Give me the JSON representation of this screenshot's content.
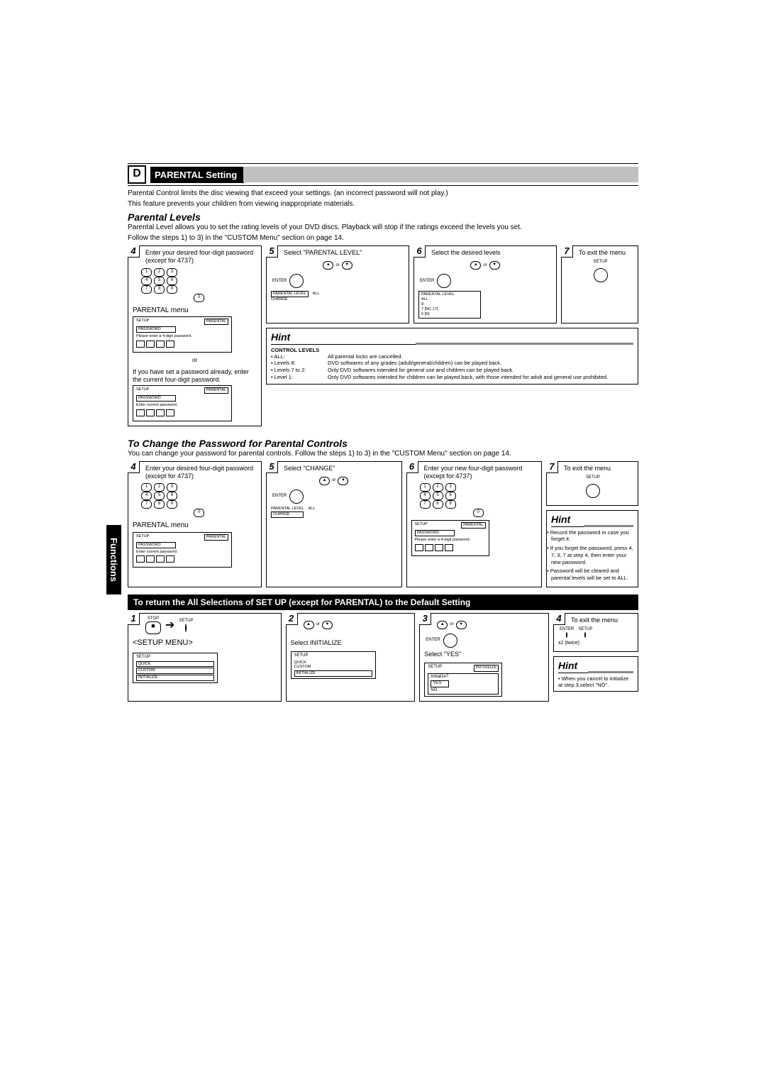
{
  "section": {
    "letter": "D",
    "title": "PARENTAL Setting",
    "intro1": "Parental Control limits the disc viewing that exceed your settings. (an incorrect password will not play.)",
    "intro2": "This feature prevents your children from viewing inappropriate materials.",
    "sub1": "Parental Levels",
    "sub1_desc1": "Parental Level allows you to set the rating levels of your DVD discs. Playback will stop if the ratings exceed the levels you set.",
    "sub1_desc2": "Follow the steps 1) to 3) in the \"CUSTOM Menu\" section on page 14."
  },
  "steps_pl": {
    "s4": {
      "num": "4",
      "text": "Enter your desired four-digit password (except for 4737)",
      "menu_cap": "PARENTAL menu",
      "or": "or",
      "or_text": "If you have set a password already, enter the current four-digit password."
    },
    "s5": {
      "num": "5",
      "text": "Select \"PARENTAL LEVEL\""
    },
    "s6": {
      "num": "6",
      "text": "Select the desired levels"
    },
    "s7": {
      "num": "7",
      "text": "To exit the menu"
    }
  },
  "mini1": {
    "setup": "SETUP",
    "tab": "PARENTAL",
    "pw": "PASSWORD",
    "prompt": "Please enter a 4-digit password.",
    "prompt2": "Enter current password."
  },
  "mini_pl": {
    "label": "PARENTAL LEVEL",
    "val": "ALL",
    "change": "CHANGE",
    "list": [
      "ALL",
      "8",
      "7 [NC-17]",
      "6 [R]"
    ]
  },
  "enter": "ENTER",
  "setup_remote": "SETUP",
  "or_token": "or",
  "hint": {
    "title": "Hint"
  },
  "control_levels": {
    "title": "CONTROL LEVELS",
    "rows": [
      {
        "k": "• ALL:",
        "v": "All parental locks are cancelled."
      },
      {
        "k": "• Levels 8:",
        "v": "DVD softwares of any grades (adult/general/children) can be played back."
      },
      {
        "k": "• Levels 7 to 2:",
        "v": "Only DVD softwares intended for general use and children can be played back."
      },
      {
        "k": "• Level 1:",
        "v": "Only DVD softwares intended for children can be played back, with those intended for adult and general use prohibited."
      }
    ]
  },
  "change_pw": {
    "title": "To Change the Password for Parental Controls",
    "desc": "You can change your password for parental controls.  Follow the steps 1) to 3) in the \"CUSTOM Menu\" section on page 14.",
    "s4": {
      "num": "4",
      "text": "Enter your desired four-digit password (except for 4737)",
      "menu_cap": "PARENTAL menu"
    },
    "s5": {
      "num": "5",
      "text": "Select \"CHANGE\""
    },
    "s6": {
      "num": "6",
      "text": "Enter your new four-digit password (except for 4737)"
    },
    "s7": {
      "num": "7",
      "text": "To exit the menu"
    },
    "hint_bullets": [
      "Record the password in case you forget it.",
      "If you forget the password, press 4, 7, 3, 7 at step 4, then enter your new password.",
      "Password will be cleared and parental levels will be set to ALL."
    ]
  },
  "reset": {
    "title": "To return the All Selections of SET UP (except for PARENTAL) to the Default Setting",
    "setup_menu_cap": "<SETUP MENU>",
    "menu": {
      "setup": "SETUP",
      "items": [
        "QUICK",
        "CUSTOM",
        "INITIALIZE"
      ]
    },
    "s1": "1",
    "stop": "STOP",
    "setup": "SETUP",
    "s2": "2",
    "s2_text": "Select INITIALIZE",
    "s3": "3",
    "s3_text": "Select \"YES\"",
    "init_menu": {
      "title": "INITIALIZE",
      "q": "Initialize?",
      "opts": [
        "YES",
        "NO"
      ]
    },
    "s4": "4",
    "s4_text": "To exit the menu",
    "x2": "x2",
    "twice": "(twice)",
    "hint": "When you cancel to initialize at step 3,select \"NO\"."
  },
  "functions_tab": "Functions"
}
